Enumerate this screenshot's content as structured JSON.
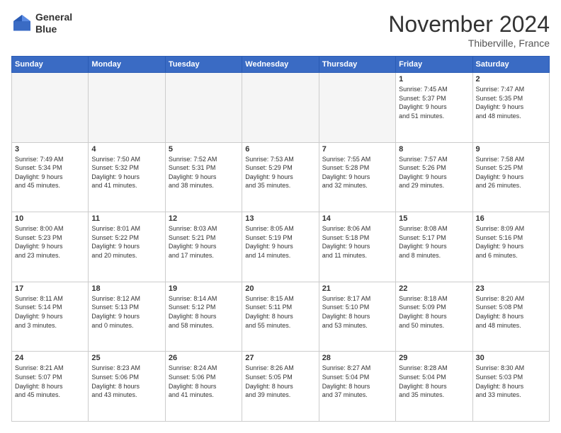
{
  "header": {
    "logo_line1": "General",
    "logo_line2": "Blue",
    "month": "November 2024",
    "location": "Thiberville, France"
  },
  "weekdays": [
    "Sunday",
    "Monday",
    "Tuesday",
    "Wednesday",
    "Thursday",
    "Friday",
    "Saturday"
  ],
  "weeks": [
    [
      {
        "day": "",
        "info": ""
      },
      {
        "day": "",
        "info": ""
      },
      {
        "day": "",
        "info": ""
      },
      {
        "day": "",
        "info": ""
      },
      {
        "day": "",
        "info": ""
      },
      {
        "day": "1",
        "info": "Sunrise: 7:45 AM\nSunset: 5:37 PM\nDaylight: 9 hours\nand 51 minutes."
      },
      {
        "day": "2",
        "info": "Sunrise: 7:47 AM\nSunset: 5:35 PM\nDaylight: 9 hours\nand 48 minutes."
      }
    ],
    [
      {
        "day": "3",
        "info": "Sunrise: 7:49 AM\nSunset: 5:34 PM\nDaylight: 9 hours\nand 45 minutes."
      },
      {
        "day": "4",
        "info": "Sunrise: 7:50 AM\nSunset: 5:32 PM\nDaylight: 9 hours\nand 41 minutes."
      },
      {
        "day": "5",
        "info": "Sunrise: 7:52 AM\nSunset: 5:31 PM\nDaylight: 9 hours\nand 38 minutes."
      },
      {
        "day": "6",
        "info": "Sunrise: 7:53 AM\nSunset: 5:29 PM\nDaylight: 9 hours\nand 35 minutes."
      },
      {
        "day": "7",
        "info": "Sunrise: 7:55 AM\nSunset: 5:28 PM\nDaylight: 9 hours\nand 32 minutes."
      },
      {
        "day": "8",
        "info": "Sunrise: 7:57 AM\nSunset: 5:26 PM\nDaylight: 9 hours\nand 29 minutes."
      },
      {
        "day": "9",
        "info": "Sunrise: 7:58 AM\nSunset: 5:25 PM\nDaylight: 9 hours\nand 26 minutes."
      }
    ],
    [
      {
        "day": "10",
        "info": "Sunrise: 8:00 AM\nSunset: 5:23 PM\nDaylight: 9 hours\nand 23 minutes."
      },
      {
        "day": "11",
        "info": "Sunrise: 8:01 AM\nSunset: 5:22 PM\nDaylight: 9 hours\nand 20 minutes."
      },
      {
        "day": "12",
        "info": "Sunrise: 8:03 AM\nSunset: 5:21 PM\nDaylight: 9 hours\nand 17 minutes."
      },
      {
        "day": "13",
        "info": "Sunrise: 8:05 AM\nSunset: 5:19 PM\nDaylight: 9 hours\nand 14 minutes."
      },
      {
        "day": "14",
        "info": "Sunrise: 8:06 AM\nSunset: 5:18 PM\nDaylight: 9 hours\nand 11 minutes."
      },
      {
        "day": "15",
        "info": "Sunrise: 8:08 AM\nSunset: 5:17 PM\nDaylight: 9 hours\nand 8 minutes."
      },
      {
        "day": "16",
        "info": "Sunrise: 8:09 AM\nSunset: 5:16 PM\nDaylight: 9 hours\nand 6 minutes."
      }
    ],
    [
      {
        "day": "17",
        "info": "Sunrise: 8:11 AM\nSunset: 5:14 PM\nDaylight: 9 hours\nand 3 minutes."
      },
      {
        "day": "18",
        "info": "Sunrise: 8:12 AM\nSunset: 5:13 PM\nDaylight: 9 hours\nand 0 minutes."
      },
      {
        "day": "19",
        "info": "Sunrise: 8:14 AM\nSunset: 5:12 PM\nDaylight: 8 hours\nand 58 minutes."
      },
      {
        "day": "20",
        "info": "Sunrise: 8:15 AM\nSunset: 5:11 PM\nDaylight: 8 hours\nand 55 minutes."
      },
      {
        "day": "21",
        "info": "Sunrise: 8:17 AM\nSunset: 5:10 PM\nDaylight: 8 hours\nand 53 minutes."
      },
      {
        "day": "22",
        "info": "Sunrise: 8:18 AM\nSunset: 5:09 PM\nDaylight: 8 hours\nand 50 minutes."
      },
      {
        "day": "23",
        "info": "Sunrise: 8:20 AM\nSunset: 5:08 PM\nDaylight: 8 hours\nand 48 minutes."
      }
    ],
    [
      {
        "day": "24",
        "info": "Sunrise: 8:21 AM\nSunset: 5:07 PM\nDaylight: 8 hours\nand 45 minutes."
      },
      {
        "day": "25",
        "info": "Sunrise: 8:23 AM\nSunset: 5:06 PM\nDaylight: 8 hours\nand 43 minutes."
      },
      {
        "day": "26",
        "info": "Sunrise: 8:24 AM\nSunset: 5:06 PM\nDaylight: 8 hours\nand 41 minutes."
      },
      {
        "day": "27",
        "info": "Sunrise: 8:26 AM\nSunset: 5:05 PM\nDaylight: 8 hours\nand 39 minutes."
      },
      {
        "day": "28",
        "info": "Sunrise: 8:27 AM\nSunset: 5:04 PM\nDaylight: 8 hours\nand 37 minutes."
      },
      {
        "day": "29",
        "info": "Sunrise: 8:28 AM\nSunset: 5:04 PM\nDaylight: 8 hours\nand 35 minutes."
      },
      {
        "day": "30",
        "info": "Sunrise: 8:30 AM\nSunset: 5:03 PM\nDaylight: 8 hours\nand 33 minutes."
      }
    ]
  ]
}
